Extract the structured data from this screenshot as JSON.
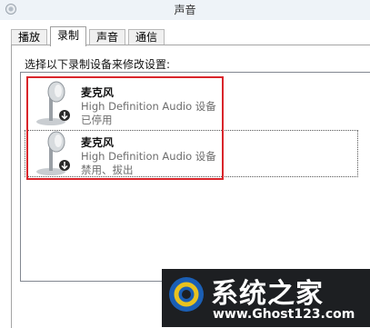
{
  "window": {
    "title": "声音"
  },
  "tabs": [
    {
      "label": "播放"
    },
    {
      "label": "录制"
    },
    {
      "label": "声音"
    },
    {
      "label": "通信"
    }
  ],
  "recording": {
    "instructions": "选择以下录制设备来修改设置:",
    "devices": [
      {
        "name": "麦克风",
        "description": "High Definition Audio 设备",
        "status": "已停用"
      },
      {
        "name": "麦克风",
        "description": "High Definition Audio 设备",
        "status": "禁用、拔出"
      }
    ]
  },
  "watermark": {
    "title": "系统之家",
    "url": "www.Ghost123.com"
  },
  "colors": {
    "highlight": "#d9252b",
    "selected_tab_bg": "#ffffff",
    "watermark_bg": "#1d1f22"
  },
  "icons": {
    "title": "speaker-icon",
    "device": "microphone-icon",
    "device_badge": "down-arrow-badge-icon"
  }
}
